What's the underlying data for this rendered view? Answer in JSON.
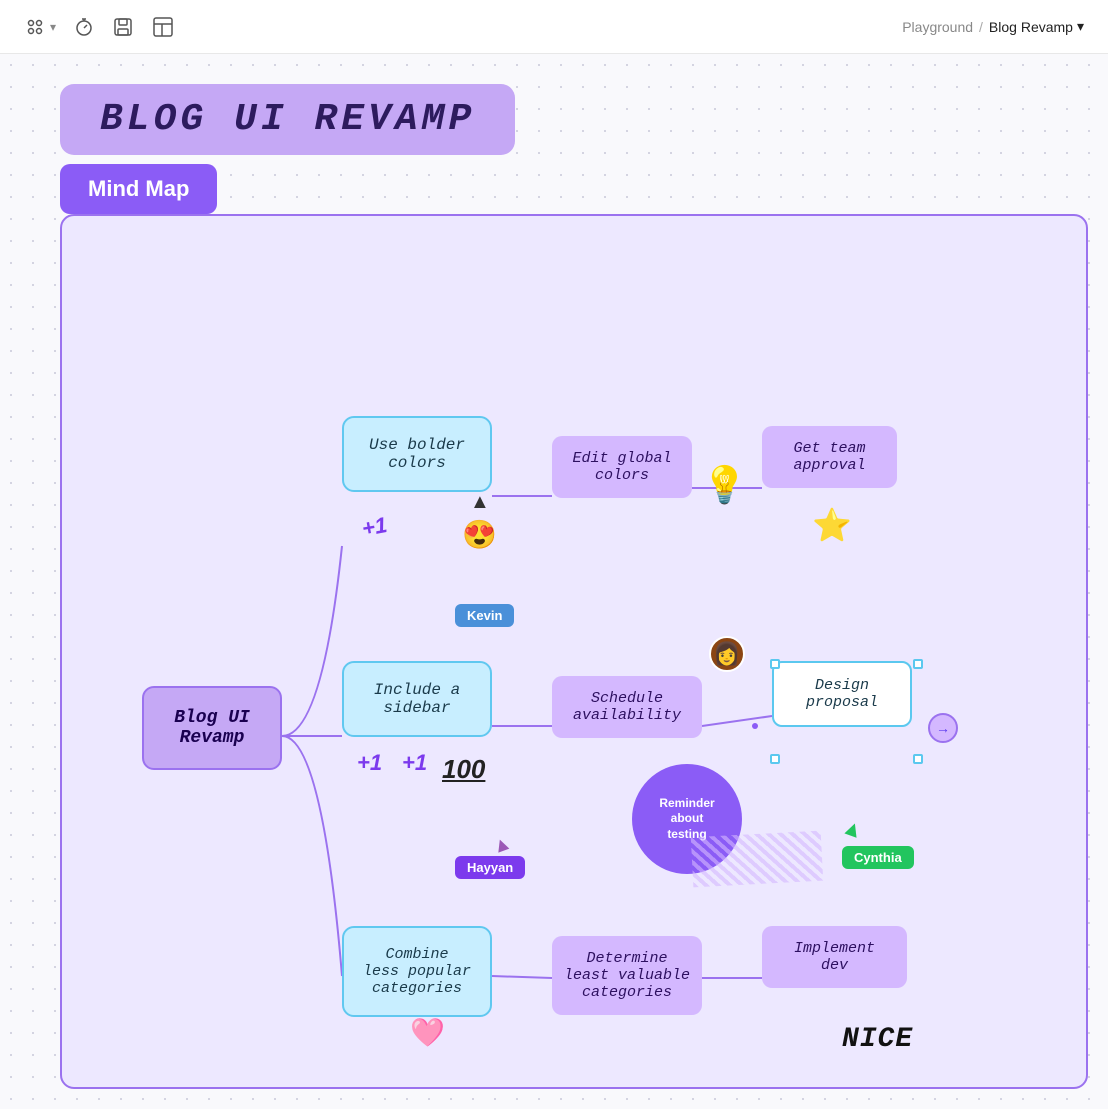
{
  "toolbar": {
    "breadcrumb_parent": "Playground",
    "breadcrumb_separator": "/",
    "breadcrumb_current": "Blog Revamp",
    "dropdown_icon": "▾"
  },
  "canvas": {
    "title": "BLOG UI REVAMP",
    "section_label": "Mind Map",
    "nodes": {
      "center": "Blog UI\nRevamp",
      "use_bolder_colors": "Use bolder\ncolors",
      "edit_global_colors": "Edit global\ncolors",
      "get_team_approval": "Get team\napproval",
      "include_sidebar": "Include a\nsidebar",
      "schedule_availability": "Schedule\navailability",
      "design_proposal": "Design\nproposal",
      "combine_categories": "Combine\nless popular\ncategories",
      "determine_least": "Determine\nleast valuable\ncategories",
      "implement_dev": "Implement\ndev"
    },
    "stickers": {
      "plus1": "+1",
      "emoji_smile": "😍",
      "lightbulb": "💡",
      "star": "⭐",
      "heart": "🩷",
      "nice": "NICE"
    },
    "name_tags": {
      "kevin": "Kevin",
      "hayyan": "Hayyan",
      "cynthia": "Cynthia"
    },
    "reminder": "Reminder\nabout\ntesting"
  }
}
